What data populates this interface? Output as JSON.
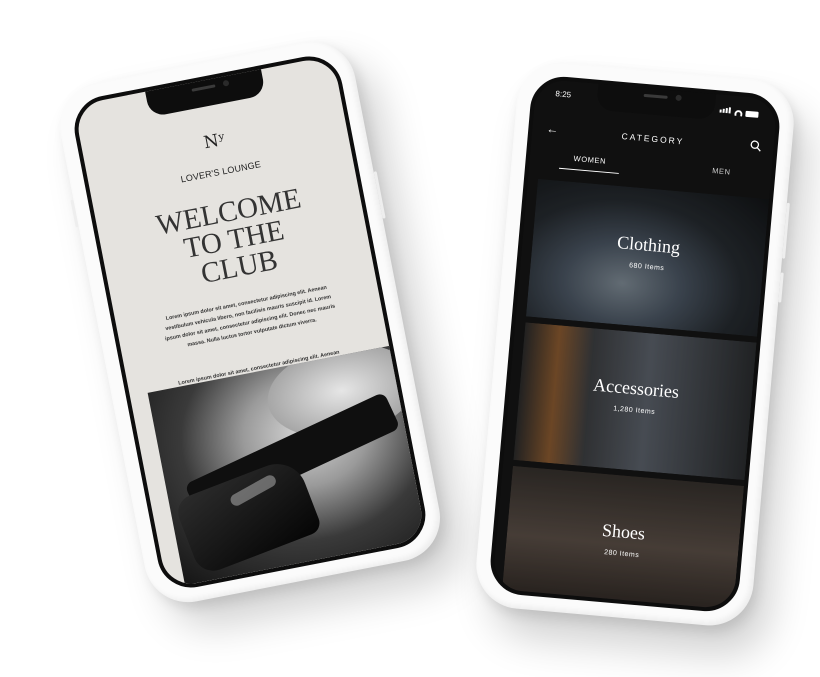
{
  "left_phone": {
    "logo": "Nʸ",
    "brand": "LOVER'S LOUNGE",
    "headline": [
      "WELCOME",
      "TO THE",
      "CLUB"
    ],
    "paragraph_1": "Lorem ipsum dolor sit amet, consectetur adipiscing elit. Aenean vestibulum vehicula libero, non facilisis mauris suscipit id. Lorem ipsum dolor sit amet, consectetur adipiscing elit. Donec nec mauris massa. Nulla luctus tortor vulputate dictum viverra.",
    "paragraph_2": "Lorem ipsum dolor sit amet, consectetur adipiscing elit. Aenean vestibulum vehicula libero, non facilisis mauris suscipit id. Lorem ipsum dolor sit amet, consectetur adipiscing elit. Donec nec mauris massa. Nulla luctus tortor vulputate dictum viverra."
  },
  "right_phone": {
    "status_time": "8:25",
    "title": "CATEGORY",
    "tabs": {
      "women": "WOMEN",
      "men": "MEN"
    },
    "categories": [
      {
        "title": "Clothing",
        "count": "680 Items"
      },
      {
        "title": "Accessories",
        "count": "1,280 Items"
      },
      {
        "title": "Shoes",
        "count": "280 Items"
      }
    ]
  }
}
